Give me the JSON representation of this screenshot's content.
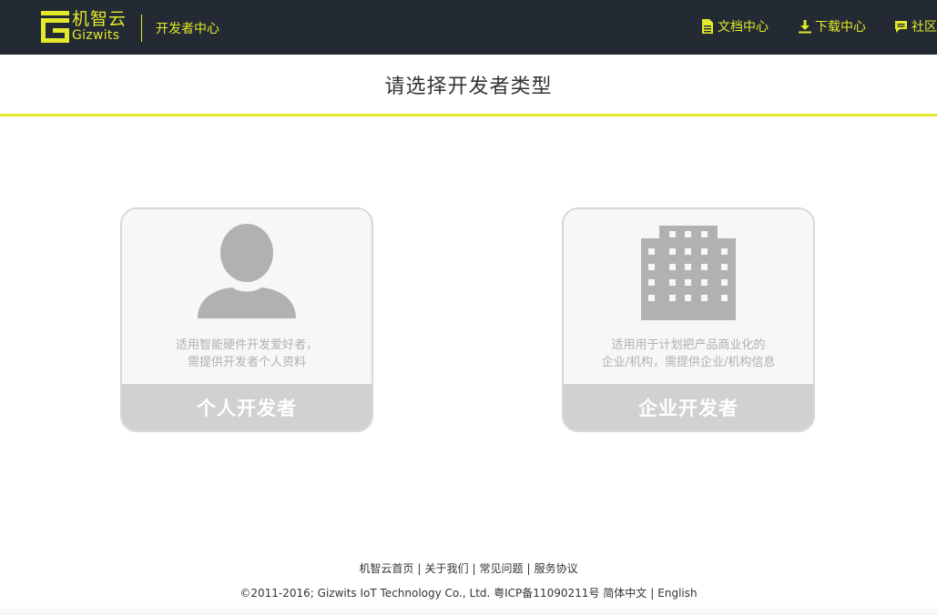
{
  "header": {
    "logo_cn": "机智云",
    "logo_en": "Gizwits",
    "portal_name": "开发者中心",
    "brand_color": "#e3e92a",
    "nav": [
      {
        "label": "文档中心",
        "icon": "document-icon"
      },
      {
        "label": "下载中心",
        "icon": "download-icon"
      },
      {
        "label": "社区",
        "icon": "chat-bubble-icon"
      }
    ]
  },
  "page": {
    "title": "请选择开发者类型"
  },
  "cards": [
    {
      "icon": "person-icon",
      "desc_line1": "适用智能硬件开发爱好者，",
      "desc_line2": "需提供开发者个人资料",
      "label": "个人开发者"
    },
    {
      "icon": "building-icon",
      "desc_line1": "适用用于计划把产品商业化的",
      "desc_line2": "企业/机构，需提供企业/机构信息",
      "label": "企业开发者"
    }
  ],
  "footer": {
    "links": [
      "机智云首页",
      "关于我们",
      "常见问题",
      "服务协议"
    ],
    "separator": "|",
    "copyright": "©2011-2016; Gizwits IoT Technology Co., Ltd. 粤ICP备11090211号",
    "lang_cn": "简体中文",
    "lang_en": "English"
  }
}
